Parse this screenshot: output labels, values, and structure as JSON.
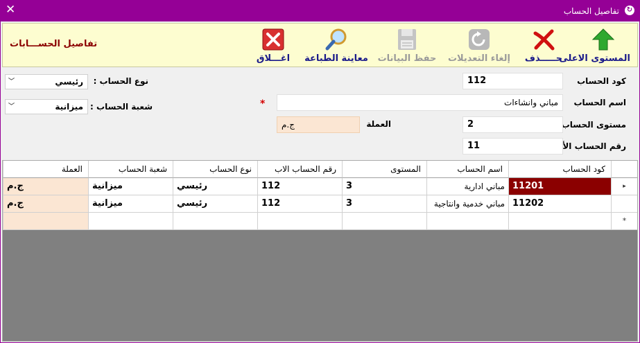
{
  "window": {
    "title": "تفاصيل الحساب",
    "close_glyph": "✕",
    "app_icon_glyph": "↻"
  },
  "toolbar": {
    "form_title": "تفاصيل الحســـابات",
    "buttons": [
      {
        "label": "المستوى الاعلى",
        "icon": "arrow-up-icon",
        "enabled": true
      },
      {
        "label": "حـــــذف",
        "icon": "delete-x-icon",
        "enabled": true
      },
      {
        "label": "إلغاء التعديلات",
        "icon": "undo-icon",
        "enabled": false
      },
      {
        "label": "حفظ البيانات",
        "icon": "save-icon",
        "enabled": false
      },
      {
        "label": "معاينة الطباعة",
        "icon": "magnifier-icon",
        "enabled": true
      },
      {
        "label": "اغـــلاق",
        "icon": "close-window-icon",
        "enabled": true
      }
    ]
  },
  "form": {
    "code": {
      "label": "كود الحساب",
      "value": "112"
    },
    "name": {
      "label": "اسم الحساب",
      "value": "مباني وانشاءات",
      "required_mark": "*"
    },
    "level": {
      "label": "مستوى الحساب",
      "value": "2"
    },
    "parent": {
      "label": "رقم الحساب الأب",
      "value": "11"
    },
    "currency": {
      "label": "العملة",
      "value": "ج.م"
    },
    "type": {
      "label": "نوع الحساب :",
      "value": "رئيسي",
      "chevron": "﹀"
    },
    "branch": {
      "label": "شعبة الحساب :",
      "value": "ميزانية",
      "chevron": "﹀"
    }
  },
  "grid": {
    "headers": [
      "كود الحساب",
      "اسم الحساب",
      "المستوى",
      "رقم الحساب الاب",
      "نوع الحساب",
      "شعبة الحساب",
      "العملة"
    ],
    "rows": [
      [
        "11201",
        "مباني ادارية",
        "3",
        "112",
        "رئيسي",
        "ميزانية",
        "ج.م"
      ],
      [
        "11202",
        "مباني خدمية وانتاجية",
        "3",
        "112",
        "رئيسي",
        "ميزانية",
        "ج.م"
      ]
    ],
    "current_row_glyph": "▸",
    "new_row_glyph": "*"
  }
}
